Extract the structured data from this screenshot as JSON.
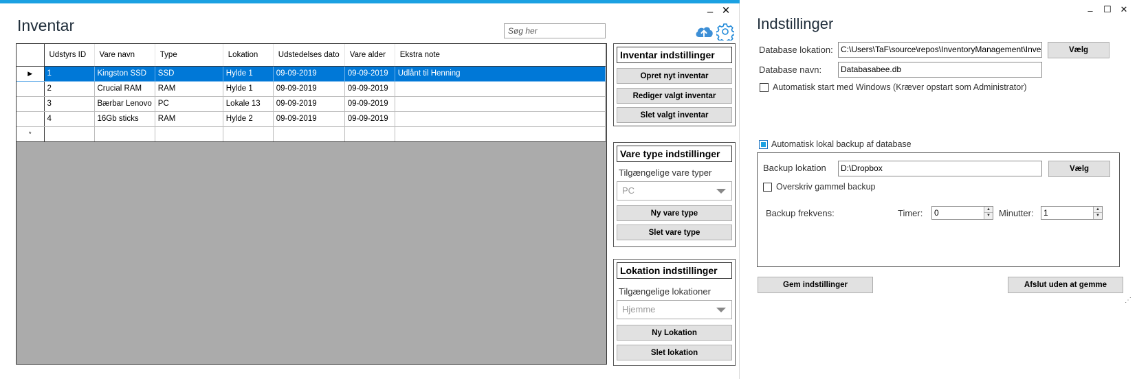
{
  "main": {
    "title": "Inventar",
    "search_placeholder": "Søg her",
    "minimize_glyph": "–",
    "close_glyph": "✕",
    "grid": {
      "columns": [
        {
          "label": "Udstyrs ID"
        },
        {
          "label": "Vare navn"
        },
        {
          "label": "Type"
        },
        {
          "label": "Lokation"
        },
        {
          "label": "Udstedelses dato"
        },
        {
          "label": "Vare alder"
        },
        {
          "label": "Ekstra note"
        }
      ],
      "rows": [
        {
          "cells": [
            "1",
            "Kingston SSD",
            "SSD",
            "Hylde 1",
            "09-09-2019",
            "09-09-2019",
            "Udlånt til Henning"
          ]
        },
        {
          "cells": [
            "2",
            "Crucial RAM",
            "RAM",
            "Hylde 1",
            "09-09-2019",
            "09-09-2019",
            ""
          ]
        },
        {
          "cells": [
            "3",
            "Bærbar Lenovo",
            "PC",
            "Lokale 13",
            "09-09-2019",
            "09-09-2019",
            ""
          ]
        },
        {
          "cells": [
            "4",
            "16Gb sticks",
            "RAM",
            "Hylde 2",
            "09-09-2019",
            "09-09-2019",
            ""
          ]
        }
      ],
      "selected_row_marker": "▶",
      "new_row_marker": "*"
    },
    "inventar_panel": {
      "title": "Inventar indstillinger",
      "btn_create": "Opret nyt inventar",
      "btn_edit": "Rediger valgt inventar",
      "btn_delete": "Slet valgt inventar"
    },
    "varetype_panel": {
      "title": "Vare type indstillinger",
      "label": "Tilgængelige vare typer",
      "selected": "PC",
      "btn_new": "Ny vare type",
      "btn_delete": "Slet vare type"
    },
    "lokation_panel": {
      "title": "Lokation indstillinger",
      "label": "Tilgængelige lokationer",
      "selected": "Hjemme",
      "btn_new": "Ny Lokation",
      "btn_delete": "Slet lokation"
    }
  },
  "settings": {
    "title": "Indstillinger",
    "minimize_glyph": "–",
    "maximize_glyph": "☐",
    "close_glyph": "✕",
    "db_location_label": "Database lokation:",
    "db_location_value": "C:\\Users\\TaF\\source\\repos\\InventoryManagement\\Inve",
    "db_choose_btn": "Vælg",
    "db_name_label": "Database navn:",
    "db_name_value": "Databasabee.db",
    "autostart_label": "Automatisk start med Windows (Kræver opstart som Administrator)",
    "autobackup_label": "Automatisk lokal backup af database",
    "backup_location_label": "Backup lokation",
    "backup_location_value": "D:\\Dropbox",
    "backup_choose_btn": "Vælg",
    "overwrite_label": "Overskriv gammel backup",
    "frequency_label": "Backup frekvens:",
    "hours_label": "Timer:",
    "hours_value": "0",
    "minutes_label": "Minutter:",
    "minutes_value": "1",
    "save_btn": "Gem indstillinger",
    "exit_btn": "Afslut uden at gemme",
    "resize_glyph": "⋰"
  },
  "colors": {
    "accent": "#1ba1e2",
    "selection": "#0078d7",
    "grid_background": "#ababab"
  },
  "icons": {
    "cloud": "cloud-upload-icon",
    "settings": "gear-icon"
  }
}
